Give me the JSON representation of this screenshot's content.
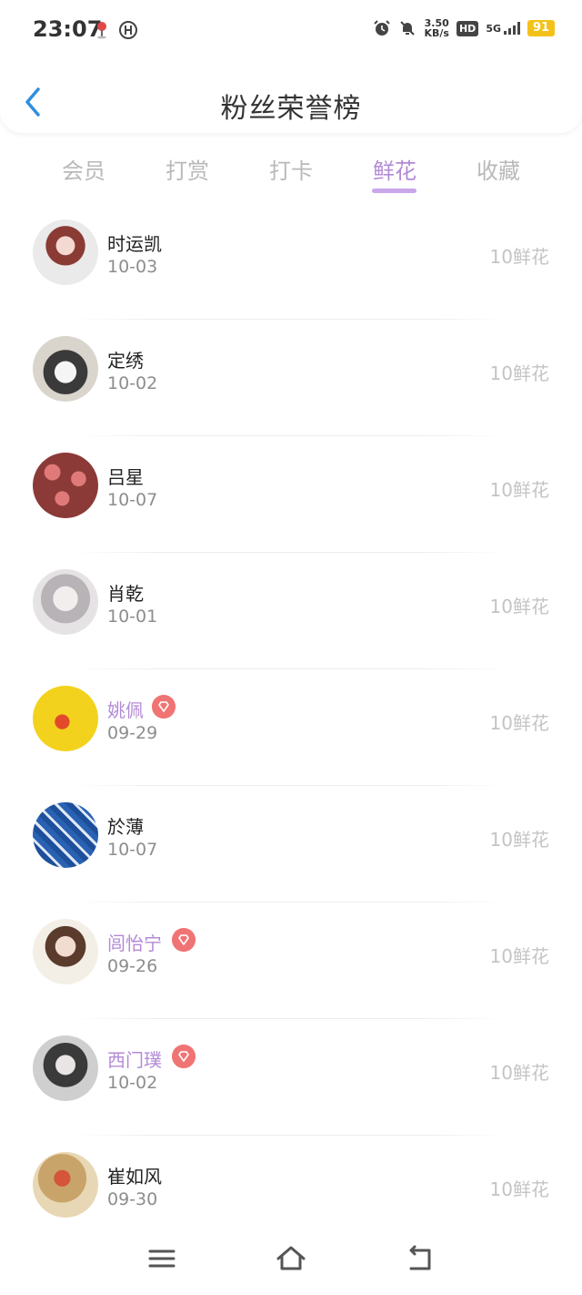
{
  "status": {
    "time": "23:07",
    "speed_top": "3.50",
    "speed_bottom": "KB/s",
    "network": "5G",
    "hd": "HD",
    "battery": "91"
  },
  "header": {
    "title": "粉丝荣誉榜",
    "back_icon": "chevron-left-icon"
  },
  "tabs": [
    {
      "label": "会员"
    },
    {
      "label": "打赏"
    },
    {
      "label": "打卡"
    },
    {
      "label": "鲜花"
    },
    {
      "label": "收藏"
    }
  ],
  "active_tab": "鲜花",
  "accent_color": "#b38ad6",
  "vip_color": "#f07474",
  "fans": [
    {
      "name": "时运凯",
      "date": "10-03",
      "amount": "10鲜花",
      "vip": false
    },
    {
      "name": "定绣",
      "date": "10-02",
      "amount": "10鲜花",
      "vip": false
    },
    {
      "name": "吕星",
      "date": "10-07",
      "amount": "10鲜花",
      "vip": false
    },
    {
      "name": "肖乾",
      "date": "10-01",
      "amount": "10鲜花",
      "vip": false
    },
    {
      "name": "姚佩",
      "date": "09-29",
      "amount": "10鲜花",
      "vip": true
    },
    {
      "name": "於薄",
      "date": "10-07",
      "amount": "10鲜花",
      "vip": false
    },
    {
      "name": "闾怡宁",
      "date": "09-26",
      "amount": "10鲜花",
      "vip": true
    },
    {
      "name": "西门璞",
      "date": "10-02",
      "amount": "10鲜花",
      "vip": true
    },
    {
      "name": "崔如风",
      "date": "09-30",
      "amount": "10鲜花",
      "vip": false
    }
  ],
  "navbar": {
    "menu_icon": "menu-icon",
    "home_icon": "home-icon",
    "back_icon": "back-icon"
  }
}
